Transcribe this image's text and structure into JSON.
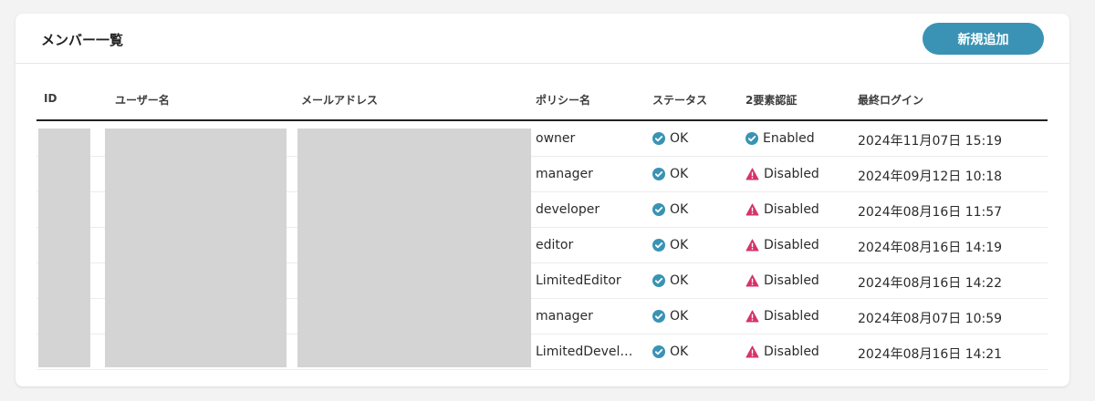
{
  "header": {
    "title": "メンバー一覧",
    "add_button_label": "新規追加"
  },
  "table": {
    "columns": [
      "ID",
      "ユーザー名",
      "メールアドレス",
      "ポリシー名",
      "ステータス",
      "2要素認証",
      "最終ログイン"
    ],
    "rows": [
      {
        "policy": "owner",
        "status": "OK",
        "two_factor": "Enabled",
        "last_login": "2024年11月07日 15:19"
      },
      {
        "policy": "manager",
        "status": "OK",
        "two_factor": "Disabled",
        "last_login": "2024年09月12日 10:18"
      },
      {
        "policy": "developer",
        "status": "OK",
        "two_factor": "Disabled",
        "last_login": "2024年08月16日 11:57"
      },
      {
        "policy": "editor",
        "status": "OK",
        "two_factor": "Disabled",
        "last_login": "2024年08月16日 14:19"
      },
      {
        "policy": "LimitedEditor",
        "status": "OK",
        "two_factor": "Disabled",
        "last_login": "2024年08月16日 14:22"
      },
      {
        "policy": "manager",
        "status": "OK",
        "two_factor": "Disabled",
        "last_login": "2024年08月07日 10:59"
      },
      {
        "policy": "LimitedDevel…",
        "status": "OK",
        "two_factor": "Disabled",
        "last_login": "2024年08月16日 14:21"
      }
    ]
  },
  "colors": {
    "accent": "#3a93b4",
    "warning": "#d6336c"
  },
  "icons": {
    "status_ok": "check-circle-icon",
    "twofa_enabled": "check-circle-icon",
    "twofa_disabled": "warning-triangle-icon"
  }
}
